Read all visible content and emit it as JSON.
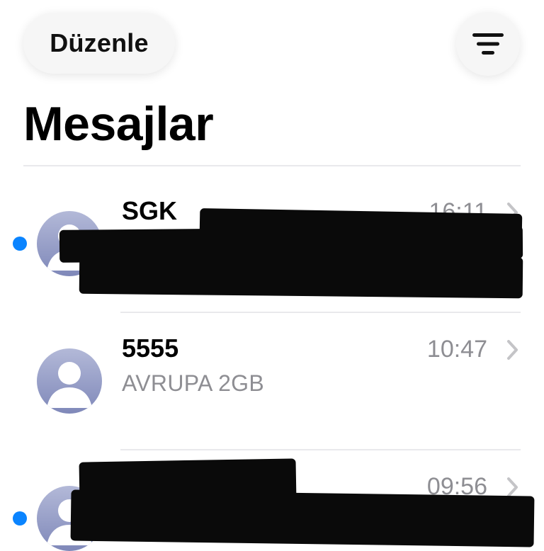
{
  "header": {
    "edit_label": "Düzenle",
    "title": "Mesajlar"
  },
  "icons": {
    "filter": "filter-lines-icon",
    "avatar": "person-avatar-icon",
    "chevron": "chevron-right-icon",
    "unread": "unread-dot-icon"
  },
  "colors": {
    "unread_dot": "#0a84ff",
    "secondary_text": "#8e8e93",
    "avatar_gradient_top": "#b3b9d8",
    "avatar_gradient_bottom": "#7f88b9"
  },
  "conversations": [
    {
      "sender": "SGK",
      "time": "16:11",
      "preview": "",
      "unread": true,
      "redacted": true
    },
    {
      "sender": "5555",
      "time": "10:47",
      "preview": "AVRUPA 2GB",
      "unread": false,
      "redacted": false
    },
    {
      "sender": "",
      "time": "09:56",
      "preview": "",
      "unread": true,
      "redacted": true
    }
  ]
}
